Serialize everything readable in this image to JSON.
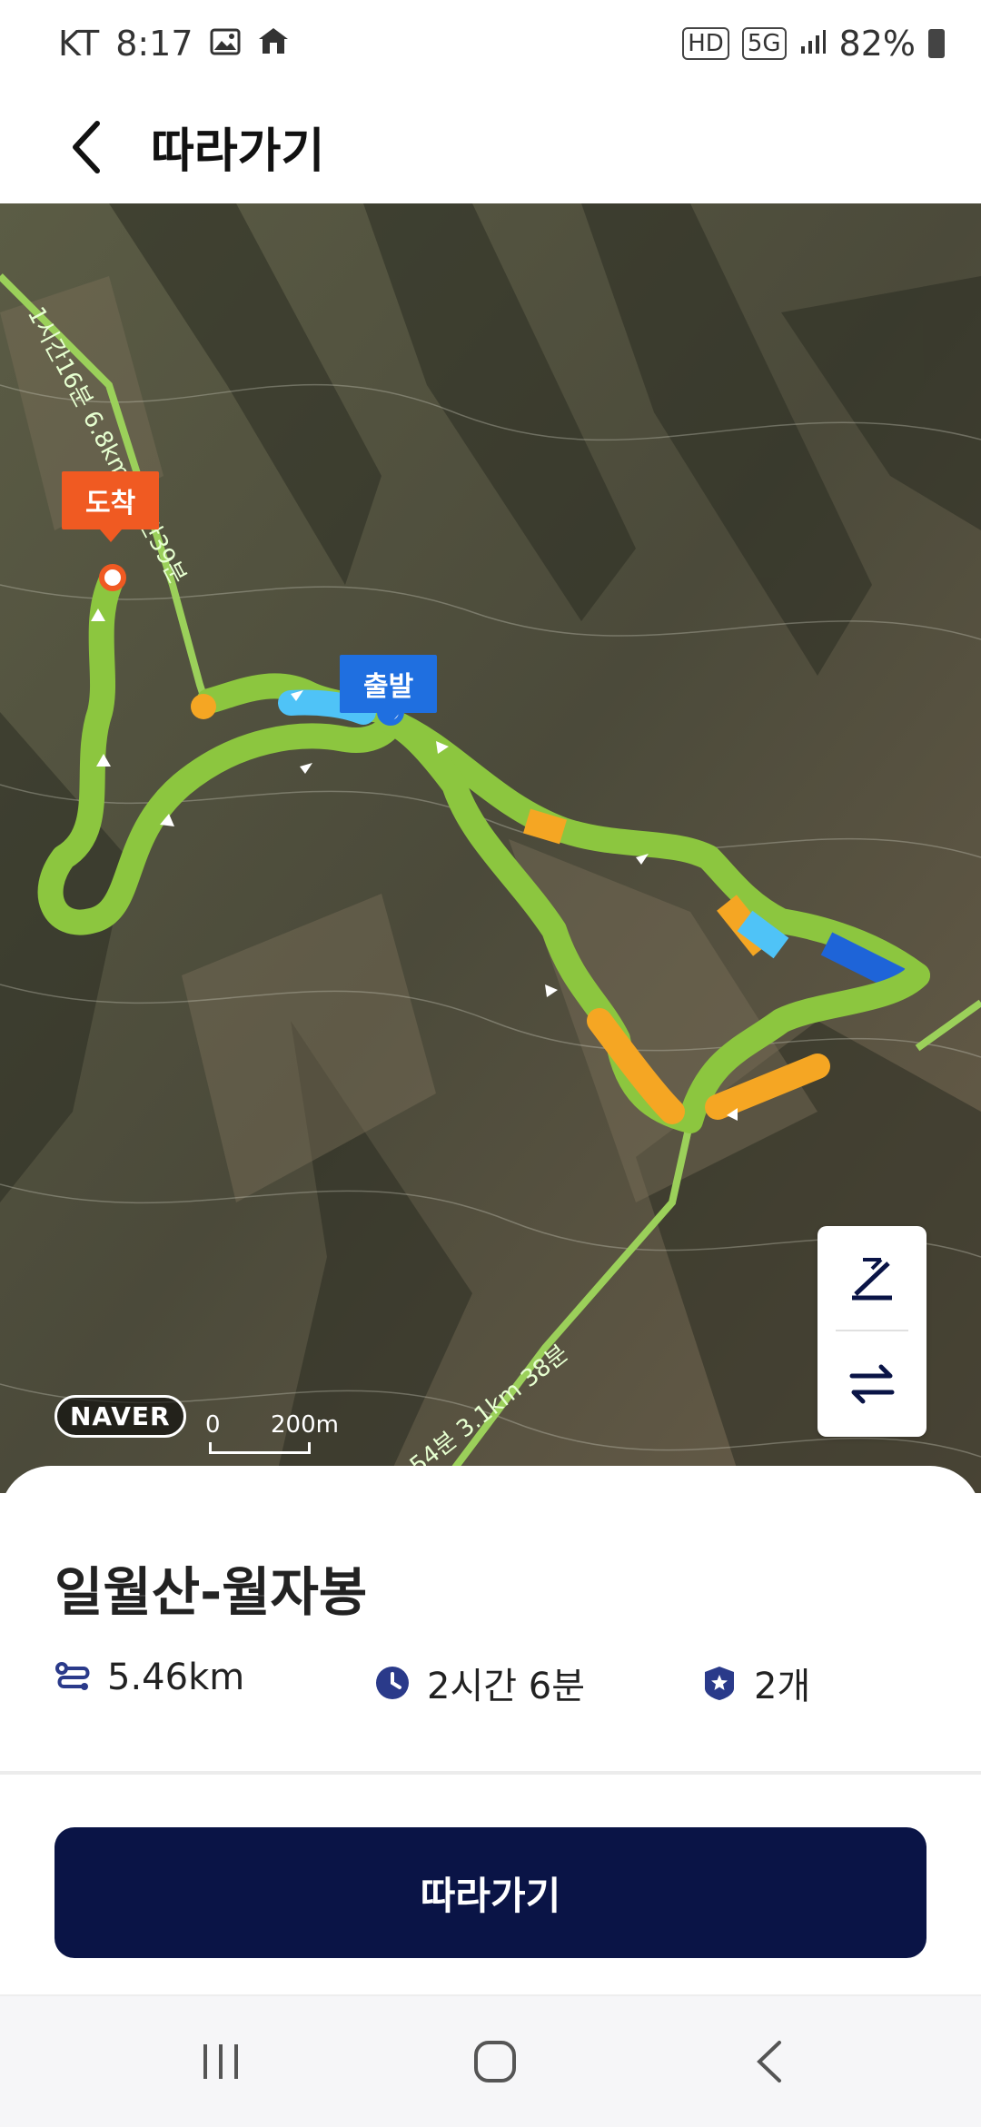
{
  "status_bar": {
    "carrier": "KT",
    "time": "8:17",
    "icons": [
      "gallery-icon",
      "app-notification-icon",
      "hd-icon",
      "5g-icon",
      "signal-icon",
      "battery-icon"
    ],
    "hd_label": "HD",
    "network_label": "5G",
    "battery_percent": "82%"
  },
  "header": {
    "title": "따라가기",
    "back_icon": "chevron-left-icon"
  },
  "map": {
    "arrival_label": "도착",
    "start_label": "출발",
    "trail_label_top": "1시간16분 6.8km 1시간39분",
    "trail_label_bottom": "54분 3.1km 38분",
    "provider": "NAVER",
    "scale_zero": "0",
    "scale_distance": "200m",
    "tools": [
      "slope-icon",
      "swap-direction-icon"
    ],
    "colors": {
      "easy": "#8cc63f",
      "moderate": "#f5a623",
      "blue_light": "#4fc3f7",
      "blue_dark": "#1e64d8"
    }
  },
  "course": {
    "name": "일월산-월자봉",
    "distance": "5.46km",
    "duration": "2시간 6분",
    "count": "2개",
    "distance_icon": "route-icon",
    "duration_icon": "clock-icon",
    "count_icon": "badge-star-icon"
  },
  "action": {
    "follow_label": "따라가기"
  },
  "nav_bar": {
    "items": [
      "recent-apps-icon",
      "home-icon",
      "back-icon"
    ]
  }
}
